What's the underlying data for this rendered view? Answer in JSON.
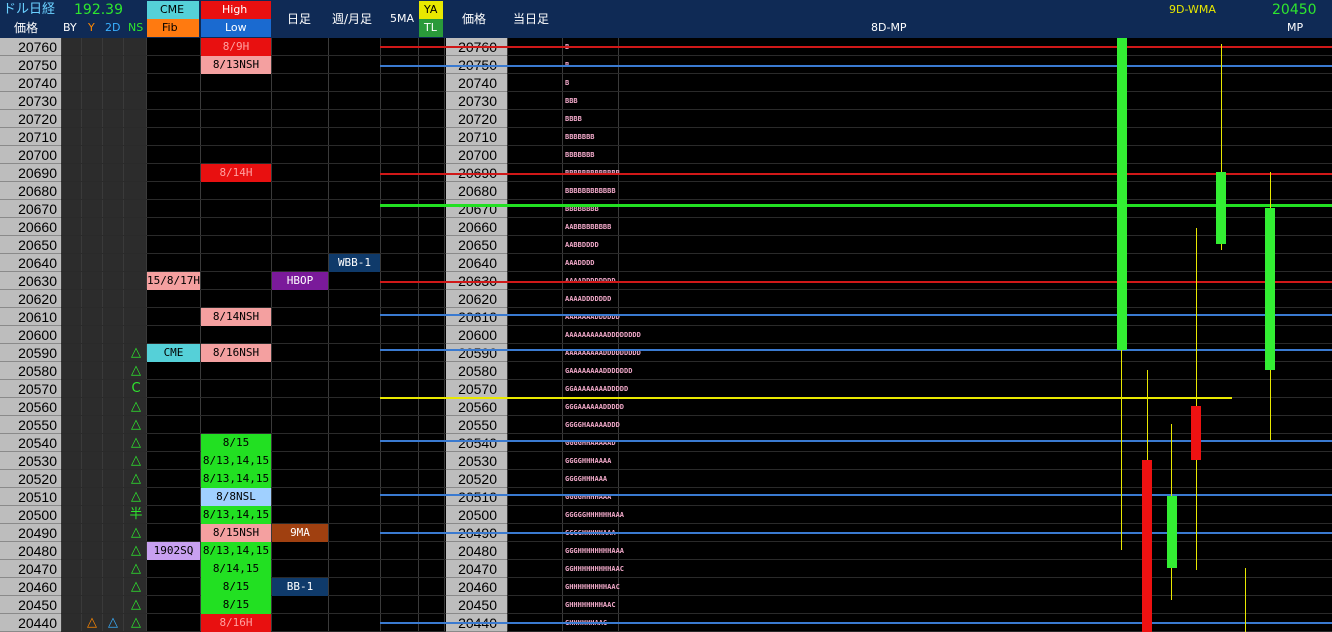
{
  "header": {
    "title": "ドル日経",
    "price_label": "価格",
    "usdjpy": "192.39",
    "by": "BY",
    "y": "Y",
    "d2": "2D",
    "ns": "NS",
    "cme": "CME",
    "fib": "Fib",
    "high": "High",
    "low": "Low",
    "daily": "日足",
    "weekly_monthly": "週/月足",
    "ma5": "5MA",
    "ya": "YA",
    "tl": "TL",
    "price2": "価格",
    "today": "当日足",
    "mp8d": "8D-MP",
    "wma9d": "9D-WMA",
    "mp_value": "20450",
    "mp": "MP"
  },
  "prices": [
    "20760",
    "20750",
    "20740",
    "20730",
    "20720",
    "20710",
    "20700",
    "20690",
    "20680",
    "20670",
    "20660",
    "20650",
    "20640",
    "20630",
    "20620",
    "20610",
    "20600",
    "20590",
    "20580",
    "20570",
    "20560",
    "20550",
    "20540",
    "20530",
    "20520",
    "20510",
    "20500",
    "20490",
    "20480",
    "20470",
    "20460",
    "20450",
    "20440"
  ],
  "ns_marks": {
    "17": "△",
    "18": "△",
    "19": "C",
    "20": "△",
    "21": "△",
    "22": "△",
    "23": "△",
    "24": "△",
    "25": "△",
    "26": "半",
    "27": "△",
    "28": "△",
    "29": "△",
    "30": "△",
    "31": "△",
    "32": "△"
  },
  "bottom_marks": {
    "y": "△",
    "d2": "△"
  },
  "cme_tags": [
    {
      "row": 13,
      "text": "15/8/17H",
      "bg": "#f4a0a0",
      "fg": "#000"
    },
    {
      "row": 17,
      "text": "CME",
      "bg": "#55d0d8",
      "fg": "#000"
    },
    {
      "row": 28,
      "text": "1902SQ",
      "bg": "#c8a0f0",
      "fg": "#000"
    }
  ],
  "hl_tags": [
    {
      "row": 0,
      "text": "8/9H",
      "bg": "#e81010",
      "fg": "#ffa0a0"
    },
    {
      "row": 1,
      "text": "8/13NSH",
      "bg": "#f4a0a0",
      "fg": "#000"
    },
    {
      "row": 7,
      "text": "8/14H",
      "bg": "#e81010",
      "fg": "#ffa0a0"
    },
    {
      "row": 15,
      "text": "8/14NSH",
      "bg": "#f4a0a0",
      "fg": "#000"
    },
    {
      "row": 17,
      "text": "8/16NSH",
      "bg": "#f4a0a0",
      "fg": "#000"
    },
    {
      "row": 22,
      "text": "8/15",
      "bg": "#22e022",
      "fg": "#000"
    },
    {
      "row": 23,
      "text": "8/13,14,15",
      "bg": "#22e022",
      "fg": "#000"
    },
    {
      "row": 24,
      "text": "8/13,14,15",
      "bg": "#22e022",
      "fg": "#000"
    },
    {
      "row": 25,
      "text": "8/8NSL",
      "bg": "#a0d0ff",
      "fg": "#000"
    },
    {
      "row": 26,
      "text": "8/13,14,15",
      "bg": "#22e022",
      "fg": "#000"
    },
    {
      "row": 27,
      "text": "8/15NSH",
      "bg": "#f4a0a0",
      "fg": "#000"
    },
    {
      "row": 28,
      "text": "8/13,14,15",
      "bg": "#22e022",
      "fg": "#000"
    },
    {
      "row": 29,
      "text": "8/14,15",
      "bg": "#22e022",
      "fg": "#000"
    },
    {
      "row": 30,
      "text": "8/15",
      "bg": "#22e022",
      "fg": "#000"
    },
    {
      "row": 31,
      "text": "8/15",
      "bg": "#22e022",
      "fg": "#000"
    },
    {
      "row": 32,
      "text": "8/16H",
      "bg": "#e81010",
      "fg": "#ffa0a0"
    }
  ],
  "daily_tags": [
    {
      "row": 13,
      "text": "HBOP",
      "bg": "#7a1a9a",
      "fg": "#fff"
    },
    {
      "row": 27,
      "text": "9MA",
      "bg": "#a04010",
      "fg": "#fff"
    },
    {
      "row": 30,
      "text": "BB-1",
      "bg": "#0f3a6a",
      "fg": "#fff"
    }
  ],
  "weekly_tags": [
    {
      "row": 12,
      "text": "WBB-1",
      "bg": "#0f3a6a",
      "fg": "#fff"
    }
  ],
  "market_profile": {
    "0": "B",
    "1": "B",
    "2": "B",
    "3": "BBB",
    "4": "BBBB",
    "5": "BBBBBBB",
    "6": "BBBBBBB",
    "7": "BBBBBBBBBBBBB",
    "8": "BBBBBBBBBBBB",
    "9": "BBBBBBBB",
    "10": "AABBBBBBBBB",
    "11": "AABBDDDD",
    "12": "AAADDDD",
    "13": "AAAADDDDDDDD",
    "14": "AAAADDDDDDD",
    "15": "AAAAAAADDDDDD",
    "16": "AAAAAAAAAADDDDDDDD",
    "17": "AAAAAAAAADDDDDDDDD",
    "18": "GAAAAAAAADDDDDDD",
    "19": "GGAAAAAAAADDDDD",
    "20": "GGGAAAAAADDDDD",
    "21": "GGGGHAAAAADDD",
    "22": "GGGGHHAAAAAD",
    "23": "GGGGHHHAAAA",
    "24": "GGGGHHHAAA",
    "25": "GGGGHHHHAAA",
    "26": "GGGGGHHHHHHAAA",
    "27": "GGGGHHHHHAAA",
    "28": "GGGHHHHHHHHAAA",
    "29": "GGHHHHHHHHHAAC",
    "30": "GHHHHHHHHHAAC",
    "31": "GHHHHHHHHAAC",
    "32": "GHHHHHHAAC"
  },
  "colors": {
    "header_bg": "#0f2a55",
    "red_line": "#d01818",
    "blue_line": "#3a7ad0",
    "green_line": "#22e022",
    "yellow_line": "#e8e800",
    "candle_up": "#33ee33",
    "candle_down": "#ee1111"
  }
}
